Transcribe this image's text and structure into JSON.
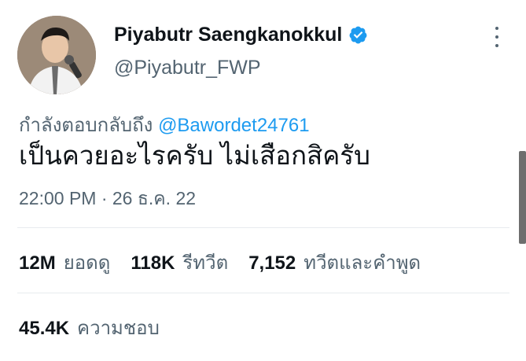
{
  "author": {
    "display_name": "Piyabutr Saengkanokkul",
    "handle": "@Piyabutr_FWP",
    "verified": true,
    "avatar_icon": "profile-photo",
    "verified_icon": "verified-badge-icon",
    "verified_color": "#1d9bf0"
  },
  "more_icon": "more-vertical-icon",
  "reply": {
    "prefix": "กำลังตอบกลับถึง",
    "mention": "@Bawordet24761"
  },
  "tweet": {
    "text": "เป็นควยอะไรครับ ไม่เสือกสิครับ",
    "timestamp": "22:00 PM · 26 ธ.ค. 22"
  },
  "stats": {
    "views_value": "12M",
    "views_label": "ยอดดู",
    "retweets_value": "118K",
    "retweets_label": "รีทวีต",
    "quotes_value": "7,152",
    "quotes_label": "ทวีตและคำพูด",
    "likes_value": "45.4K",
    "likes_label": "ความชอบ"
  },
  "colors": {
    "text_primary": "#0f1419",
    "text_secondary": "#536471",
    "accent": "#1d9bf0",
    "divider": "#e7ebee"
  }
}
